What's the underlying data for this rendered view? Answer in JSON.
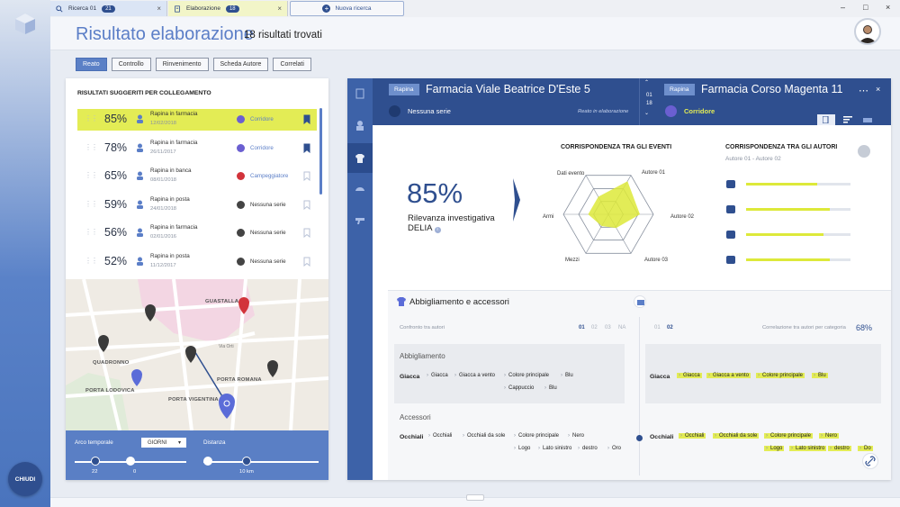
{
  "tabs": [
    {
      "label": "Ricerca 01",
      "badge": "21",
      "icon": "search-icon"
    },
    {
      "label": "Elaborazione",
      "badge": "18",
      "icon": "document-icon"
    },
    {
      "label": "Nuova ricerca",
      "icon": "plus-icon"
    }
  ],
  "header": {
    "title": "Risultato elaborazione",
    "count": "18 risultati trovati"
  },
  "filters": [
    "Reato",
    "Controllo",
    "Rinvenimento",
    "Scheda Autore",
    "Correlati"
  ],
  "left": {
    "title": "RISULTATI SUGGERITI PER COLLEGAMENTO",
    "rows": [
      {
        "pct": "85%",
        "crime": "Rapina in farmacia",
        "date": "12/02/2018",
        "series": "Corridore",
        "series_color": "#6b5fd1",
        "bookmarked": true
      },
      {
        "pct": "78%",
        "crime": "Rapina in farmacia",
        "date": "26/11/2017",
        "series": "Corridore",
        "series_color": "#6b5fd1",
        "bookmarked": true
      },
      {
        "pct": "65%",
        "crime": "Rapina in banca",
        "date": "08/01/2018",
        "series": "Campeggiatore",
        "series_color": "#d2333b",
        "bookmarked": false
      },
      {
        "pct": "59%",
        "crime": "Rapina in posta",
        "date": "24/01/2018",
        "series": "Nessuna serie",
        "series_color": "#444444",
        "bookmarked": false
      },
      {
        "pct": "56%",
        "crime": "Rapina in farmacia",
        "date": "02/01/2016",
        "series": "Nessuna serie",
        "series_color": "#444444",
        "bookmarked": false
      },
      {
        "pct": "52%",
        "crime": "Rapina in posta",
        "date": "11/12/2017",
        "series": "Nessuna serie",
        "series_color": "#444444",
        "bookmarked": false
      }
    ],
    "map": {
      "labels": [
        "GUASTALLA",
        "QUADRONNO",
        "PORTA ROMANA",
        "PORTA LODOVICA",
        "PORTA VIGENTINA"
      ],
      "streets": [
        "Via Orti"
      ]
    },
    "controls": {
      "time_label": "Arco temporale",
      "unit": "GIORNI",
      "distance_label": "Distanza",
      "time_values": [
        "22",
        "0"
      ],
      "distance_value": "10 km"
    }
  },
  "right": {
    "left_chip": "Rapina",
    "left_title": "Farmacia Viale Beatrice D'Este 5",
    "left_series": "Nessuna serie",
    "left_note": "Reato in elaborazione",
    "pager": [
      "01",
      "18"
    ],
    "right_chip": "Rapina",
    "right_title": "Farmacia Corso Magenta 11",
    "right_series": "Corridore",
    "relevance_pct": "85%",
    "relevance_label": "Rilevanza investigativa",
    "relevance_sub": "DELIA",
    "events_title": "CORRISPONDENZA TRA GLI EVENTI",
    "radar_labels": [
      "Dati evento",
      "Autore 01",
      "Autore 02",
      "Autore 03",
      "Mezzi",
      "Armi"
    ],
    "radar_values": [
      0.45,
      0.85,
      0.7,
      0.35,
      0.3,
      0.45
    ],
    "authors_title": "CORRISPONDENZA TRA GLI AUTORI",
    "authors_sub": "Autore 01 - Autore 02",
    "author_bars": [
      0.68,
      0.8,
      0.74,
      0.8
    ],
    "accessories_title": "Abbigliamento e accessori",
    "compare_label": "Confronto tra autori",
    "left_nums": [
      "01",
      "02",
      "03",
      "NA"
    ],
    "right_nums": [
      "01",
      "02"
    ],
    "corr_label": "Correlazione tra autori per categoria",
    "corr_value": "68%",
    "cat1": "Abbigliamento",
    "key1": "Giacca",
    "tags1_left": [
      "Giacca",
      "Giacca a vento",
      "Colore principale",
      "Blu",
      "Cappuccio",
      "Blu"
    ],
    "tags1_right": [
      "Giacca",
      "Giacca a vento",
      "Colore principale",
      "Blu"
    ],
    "cat2": "Accessori",
    "key2": "Occhiali",
    "tags2_left": [
      "Occhiali",
      "Occhiali da sole",
      "Colore principale",
      "Nero",
      "Logo",
      "Lato sinistro",
      "destro",
      "Oro"
    ],
    "tags2_right": [
      "Occhiali",
      "Occhiali da sole",
      "Colore principale",
      "Nero",
      "Logo",
      "Lato sinistro",
      "destro",
      "Do"
    ]
  },
  "close_label": "CHIUDI"
}
